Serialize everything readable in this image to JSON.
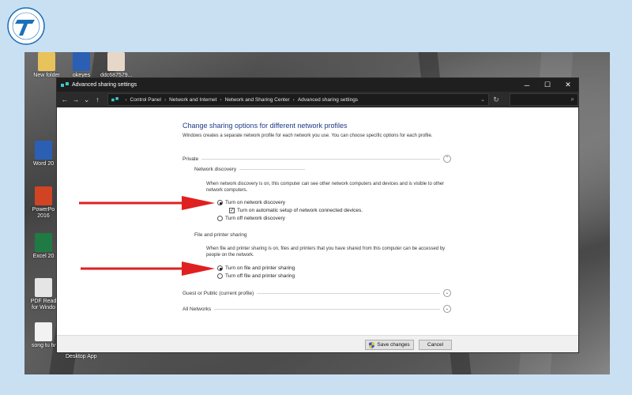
{
  "colors": {
    "page_bg": "#c9e0f3",
    "link_blue": "#1e3a8a",
    "arrow_red": "#e02020"
  },
  "desktop_icons": {
    "new_folder": "New folder",
    "okeyes": "okeyes",
    "ddc": "ddc687579...",
    "word": "Word 20",
    "powerpoint": "PowerPo 2016",
    "excel": "Excel 20",
    "pdf": "PDF Read for Windo",
    "song": "song tu tv",
    "desktop_app": "Desktop App"
  },
  "window": {
    "title": "Advanced sharing settings",
    "controls": {
      "minimize": "─",
      "maximize": "☐",
      "close": "✕"
    },
    "nav": {
      "back": "←",
      "forward": "→",
      "recent": "⌄",
      "up": "↑"
    },
    "breadcrumb": [
      "Control Panel",
      "Network and Internet",
      "Network and Sharing Center",
      "Advanced sharing settings"
    ],
    "address_dropdown": "⌄",
    "refresh": "↻",
    "search_icon": "⌕"
  },
  "content": {
    "heading": "Change sharing options for different network profiles",
    "description": "Windows creates a separate network profile for each network you use. You can choose specific options for each profile.",
    "private": {
      "label": "Private",
      "toggle": "⌃",
      "network_discovery": {
        "label": "Network discovery",
        "text": "When network discovery is on, this computer can see other network computers and devices and is visible to other network computers.",
        "turn_on": "Turn on network discovery",
        "auto_setup": "Turn on automatic setup of network connected devices.",
        "turn_off": "Turn off network discovery",
        "selected": "on",
        "auto_setup_checked": true
      },
      "file_printer": {
        "label": "File and printer sharing",
        "text": "When file and printer sharing is on, files and printers that you have shared from this computer can be accessed by people on the network.",
        "turn_on": "Turn on file and printer sharing",
        "turn_off": "Turn off file and printer sharing",
        "selected": "on"
      }
    },
    "guest_public": {
      "label": "Guest or Public (current profile)",
      "toggle": "⌄"
    },
    "all_networks": {
      "label": "All Networks",
      "toggle": "⌄"
    }
  },
  "footer": {
    "save": "Save changes",
    "cancel": "Cancel"
  }
}
